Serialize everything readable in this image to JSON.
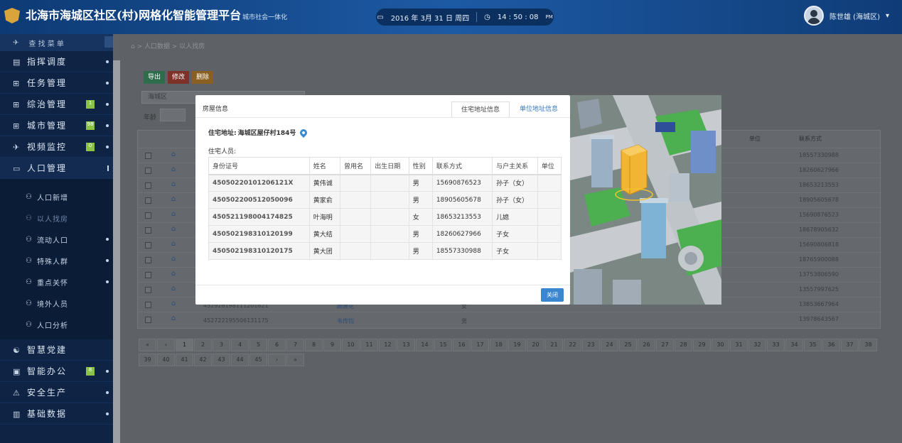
{
  "header": {
    "title": "北海市海城区社区(村)网格化智能管理平台",
    "subtitle": "城市社会一体化",
    "date": "2016 年 3月 31 日 周四",
    "time": "14 : 50 : 08",
    "ampm": "PM",
    "user_name": "陈世雄 (海城区)"
  },
  "sidebar": {
    "toggle_label": "查 找 菜 单",
    "items": [
      {
        "label": "指挥调度",
        "icon": "list-icon"
      },
      {
        "label": "任务管理",
        "icon": "grid-icon"
      },
      {
        "label": "综治管理",
        "icon": "grid-icon",
        "badge": "1"
      },
      {
        "label": "城市管理",
        "icon": "grid-icon",
        "badge": "98"
      },
      {
        "label": "视频监控",
        "icon": "plane-icon",
        "badge": "0"
      },
      {
        "label": "人口管理",
        "icon": "id-card-icon"
      }
    ],
    "subitems": [
      {
        "label": "人口新增"
      },
      {
        "label": "以人找房"
      },
      {
        "label": "流动人口"
      },
      {
        "label": "特殊人群"
      },
      {
        "label": "重点关怀"
      },
      {
        "label": "境外人员"
      },
      {
        "label": "人口分析"
      }
    ],
    "lower_items": [
      {
        "label": "智慧党建",
        "icon": "handshake-icon"
      },
      {
        "label": "智能办公",
        "icon": "office-icon",
        "badge": "8"
      },
      {
        "label": "安全生产",
        "icon": "warning-icon"
      },
      {
        "label": "基础数据",
        "icon": "chart-icon"
      }
    ]
  },
  "main": {
    "breadcrumb": "人口数据  >  以人找房",
    "buttons": {
      "export": "导出",
      "edit": "修改",
      "delete": "删除"
    },
    "filter_district": "海城区",
    "filter_age_label": "年龄",
    "table_header_unit": "单位",
    "table_header_phone": "联系方式",
    "background_phones": [
      "18557330988",
      "18260627966",
      "18653213553",
      "18905605678",
      "15690876523",
      "18678905632",
      "15690806818",
      "18765900088",
      "13753806590",
      "13557997625",
      "13853667964",
      "13978643567"
    ],
    "bg_row_ids": [
      "452928198111201821",
      "452722195506131175"
    ],
    "bg_row_names": [
      "顾建花",
      "韦传钧"
    ],
    "bg_row_sex": [
      "女",
      "男"
    ],
    "pages": [
      "«",
      "‹",
      "1",
      "2",
      "3",
      "4",
      "5",
      "6",
      "7",
      "8",
      "9",
      "10",
      "11",
      "12",
      "13",
      "14",
      "15",
      "16",
      "17",
      "18",
      "19",
      "20",
      "21",
      "22",
      "23",
      "24",
      "25",
      "26",
      "27",
      "28",
      "29",
      "30",
      "31",
      "32",
      "33",
      "34",
      "35",
      "36",
      "37",
      "38",
      "39",
      "40",
      "41",
      "42",
      "43",
      "44",
      "45",
      "›",
      "»"
    ]
  },
  "modal": {
    "title": "房屋信息",
    "tab_home": "住宅地址信息",
    "tab_work": "单位地址信息",
    "address_label": "住宅地址:",
    "address_value": "海城区屋仔村184号",
    "residents_label": "住宅人员:",
    "columns": [
      "身份证号",
      "姓名",
      "曾用名",
      "出生日期",
      "性别",
      "联系方式",
      "与户主关系",
      "单位"
    ],
    "rows": [
      [
        "45050220101206121X",
        "黄伟诚",
        "",
        "",
        "男",
        "15690876523",
        "孙子（女）",
        ""
      ],
      [
        "450502200512050096",
        "黄家俞",
        "",
        "",
        "男",
        "18905605678",
        "孙子（女）",
        ""
      ],
      [
        "450521198004174825",
        "叶海明",
        "",
        "",
        "女",
        "18653213553",
        "儿媳",
        ""
      ],
      [
        "450502198310120199",
        "黄大结",
        "",
        "",
        "男",
        "18260627966",
        "子女",
        ""
      ],
      [
        "450502198310120175",
        "黄大团",
        "",
        "",
        "男",
        "18557330988",
        "子女",
        ""
      ]
    ],
    "close_label": "关闭"
  },
  "colors": {
    "export": "#3a9a66",
    "edit": "#c9412f",
    "delete": "#d88b25",
    "accent": "#3a87cf"
  }
}
